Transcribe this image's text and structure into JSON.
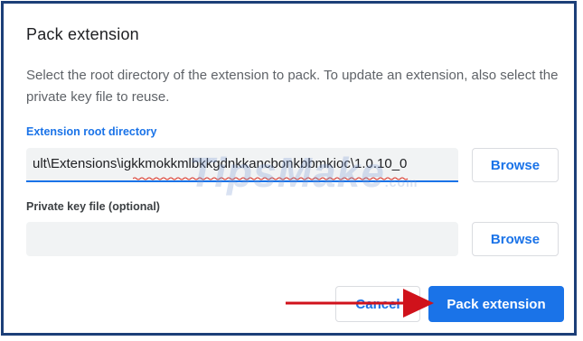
{
  "dialog": {
    "title": "Pack extension",
    "description": "Select the root directory of the extension to pack. To update an extension, also select the private key file to reuse."
  },
  "root_directory": {
    "label": "Extension root directory",
    "value": "ult\\Extensions\\igkkmokkmlbkkgdnkkancbonkbbmkioc\\1.0.10_0",
    "browse_label": "Browse"
  },
  "private_key": {
    "label": "Private key file (optional)",
    "value": "",
    "browse_label": "Browse"
  },
  "actions": {
    "cancel_label": "Cancel",
    "pack_label": "Pack extension"
  },
  "watermark": {
    "text": "TipsMake",
    "suffix": ".com"
  },
  "colors": {
    "accent": "#1a73e8",
    "frame": "#1c3f78",
    "annotation_arrow": "#d0121b"
  }
}
